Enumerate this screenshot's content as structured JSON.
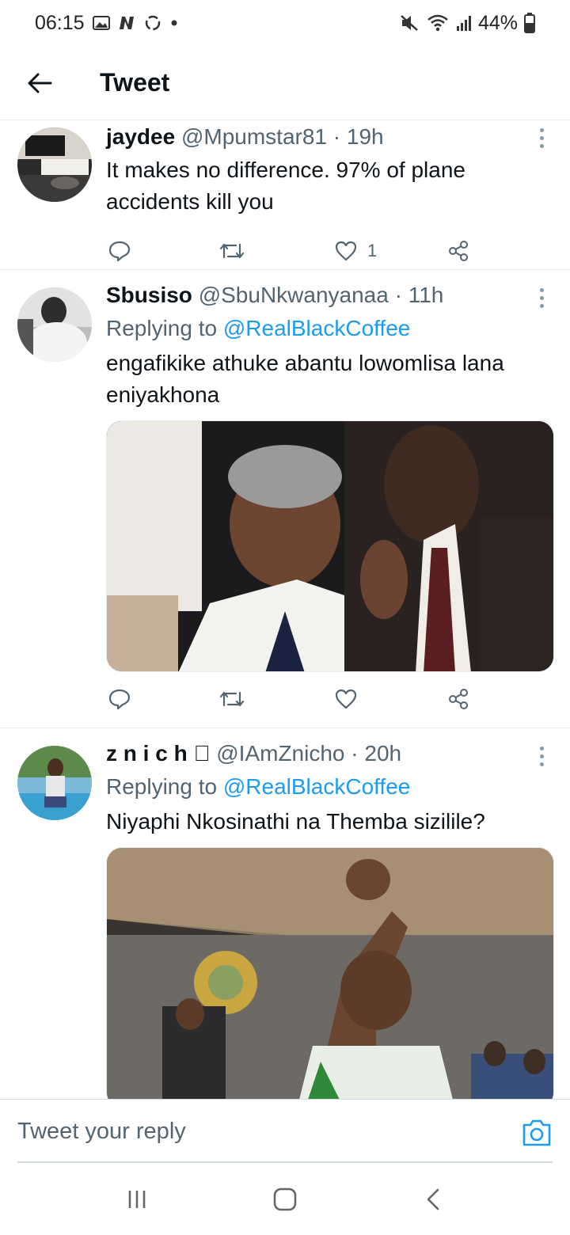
{
  "status_bar": {
    "time": "06:15",
    "battery": "44%"
  },
  "header": {
    "title": "Tweet"
  },
  "tweets": [
    {
      "name": "jaydee",
      "handle": "@Mpumstar81",
      "time": "19h",
      "replying_to": "",
      "text": "It makes no difference. 97% of plane accidents kill you",
      "likes": "1",
      "has_media": false
    },
    {
      "name": "Sbusiso",
      "handle": "@SbuNkwanyanaa",
      "time": "11h",
      "replying_label": "Replying to",
      "replying_to": "@RealBlackCoffee",
      "text": "engafikike athuke abantu lowomlisa lana eniyakhona",
      "likes": "",
      "has_media": true
    },
    {
      "name": "z n i c h ",
      "handle": "@IAmZnicho",
      "time": "20h",
      "replying_label": "Replying to",
      "replying_to": "@RealBlackCoffee",
      "text": "Niyaphi Nkosinathi na Themba sizilile?",
      "likes": "",
      "has_media": true
    }
  ],
  "reply_bar": {
    "placeholder": "Tweet your reply"
  },
  "colors": {
    "link": "#1d9bf0",
    "meta": "#536471",
    "divider": "#e6ecf0"
  },
  "icons": [
    "back-arrow-icon",
    "comment-icon",
    "retweet-icon",
    "heart-icon",
    "share-icon",
    "more-icon",
    "camera-icon",
    "recents-icon",
    "home-icon",
    "back-nav-icon"
  ]
}
